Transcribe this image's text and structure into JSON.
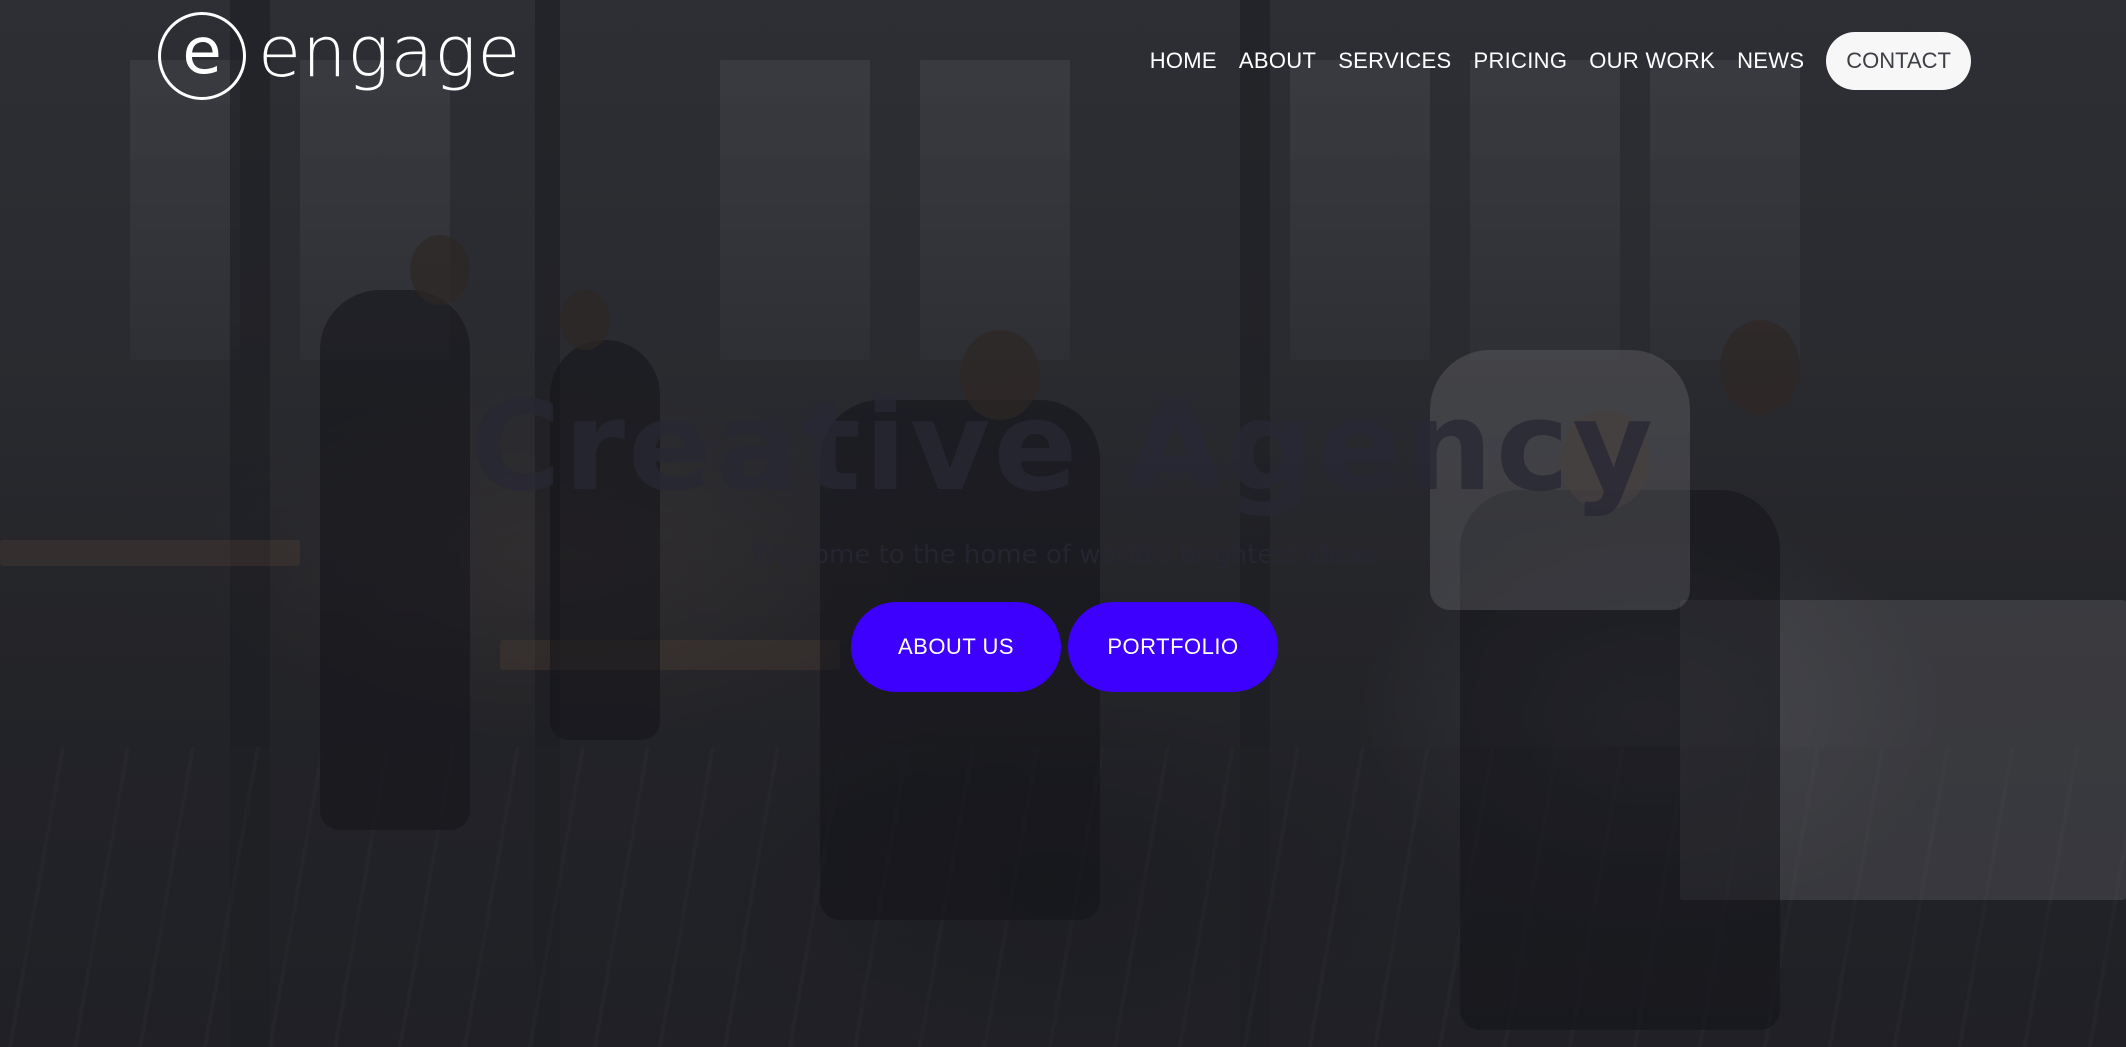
{
  "brand": {
    "logo_letter": "e",
    "name": "engage"
  },
  "nav": {
    "items": [
      "HOME",
      "ABOUT",
      "SERVICES",
      "PRICING",
      "OUR WORK",
      "NEWS"
    ],
    "contact": "CONTACT"
  },
  "hero": {
    "title": "Creative Agency",
    "subtitle": "Welcome to the home of world's brightest ideas",
    "buttons": [
      "ABOUT US",
      "PORTFOLIO"
    ]
  },
  "colors": {
    "accent": "#3d00ff",
    "contact_bg": "#f7f7f8",
    "text_light": "#ffffff"
  }
}
